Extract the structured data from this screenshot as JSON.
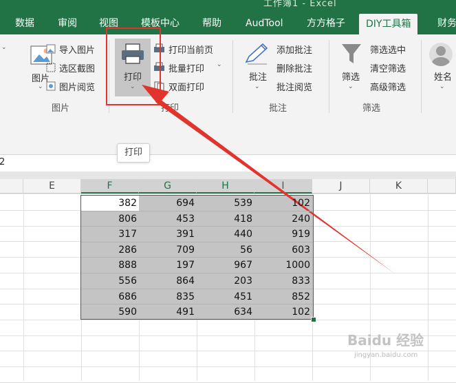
{
  "window": {
    "title": "工作簿1 - Excel"
  },
  "tabs": [
    "数据",
    "审阅",
    "视图",
    "模板中心",
    "帮助",
    "AudTool",
    "方方格子",
    "DIY工具箱",
    "财务"
  ],
  "ribbon": {
    "picture_group": {
      "label": "图片",
      "big_button": "图片",
      "items": [
        "导入图片",
        "选区截图",
        "图片阅览"
      ]
    },
    "print_group": {
      "label": "打印",
      "big_button": "打印",
      "items": [
        "打印当前页",
        "批量打印",
        "双面打印"
      ]
    },
    "comment_group": {
      "label": "批注",
      "big_button": "批注",
      "items": [
        "添加批注",
        "删除批注",
        "批注阅览"
      ]
    },
    "filter_group": {
      "label": "筛选",
      "big_button": "筛选",
      "items": [
        "筛选选中",
        "清空筛选",
        "高级筛选"
      ]
    },
    "name_group": {
      "big_button": "姓名"
    }
  },
  "tooltip": "打印",
  "formula_bar": {
    "value": "2"
  },
  "columns": [
    "E",
    "F",
    "G",
    "H",
    "I",
    "J",
    "K"
  ],
  "grid_rows": [
    [
      382,
      694,
      539,
      102
    ],
    [
      806,
      453,
      418,
      240
    ],
    [
      317,
      391,
      440,
      919
    ],
    [
      286,
      709,
      56,
      603
    ],
    [
      888,
      197,
      967,
      1000
    ],
    [
      556,
      864,
      203,
      833
    ],
    [
      686,
      835,
      451,
      852
    ],
    [
      590,
      491,
      634,
      102
    ]
  ],
  "watermark": {
    "text": "Baidu 经验",
    "sub": "jingyan.baidu.com"
  },
  "colors": {
    "excel_green": "#217346",
    "highlight_red": "#e2332c",
    "selection_gray": "#c4c4c4"
  }
}
